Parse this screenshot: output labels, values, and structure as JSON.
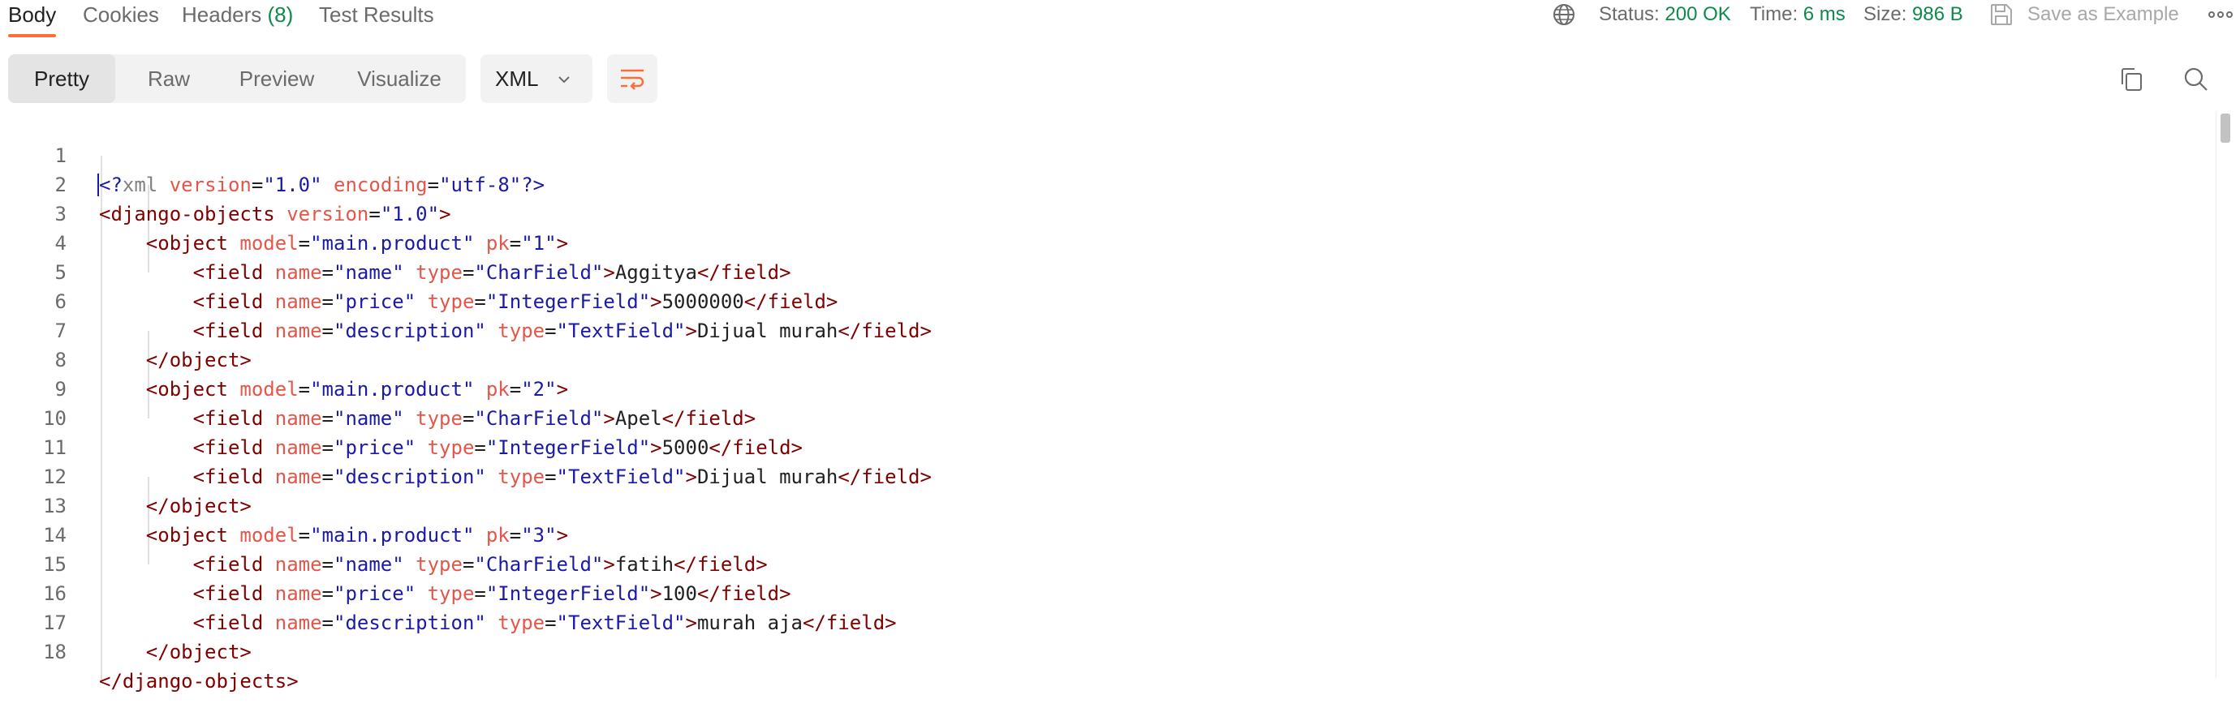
{
  "tabs": [
    {
      "label": "Body",
      "active": true
    },
    {
      "label": "Cookies"
    },
    {
      "label": "Headers",
      "count": "(8)"
    },
    {
      "label": "Test Results"
    }
  ],
  "response_meta": {
    "status_label": "Status:",
    "status_value": "200 OK",
    "time_label": "Time:",
    "time_value": "6 ms",
    "size_label": "Size:",
    "size_value": "986 B"
  },
  "save_label": "Save as Example",
  "view_modes": [
    "Pretty",
    "Raw",
    "Preview",
    "Visualize"
  ],
  "format": "XML",
  "icons": {
    "globe": "globe-icon",
    "save": "save-icon",
    "more": "more-icon",
    "chevron": "chevron-down-icon",
    "wrap": "wrap-lines-icon",
    "copy": "copy-icon",
    "search": "search-icon"
  },
  "colors": {
    "accent": "#ff6c37",
    "success": "#0d8a4b",
    "tag": "#800000",
    "attribute": "#e45649",
    "attribute_value": "#1a1aa6"
  },
  "code_lines": [
    "1",
    "2",
    "3",
    "4",
    "5",
    "6",
    "7",
    "8",
    "9",
    "10",
    "11",
    "12",
    "13",
    "14",
    "15",
    "16",
    "17",
    "18"
  ],
  "code": {
    "pi_open": "<?",
    "pi_name": "xml",
    "pi_attr1": "version",
    "pi_val1": "\"1.0\"",
    "pi_attr2": "encoding",
    "pi_val2": "\"utf-8\"",
    "pi_close": "?>",
    "root_open": "<django-objects",
    "root_attr": "version",
    "root_val": "\"1.0\"",
    "root_close": "</django-objects>",
    "object_tag": "<object",
    "object_close": "</object>",
    "model_attr": "model",
    "model_val": "\"main.product\"",
    "pk_attr": "pk",
    "field_tag": "<field",
    "field_close": "</field>",
    "name_attr": "name",
    "type_attr": "type",
    "objects": [
      {
        "pk": "\"1\"",
        "fields": [
          {
            "name": "\"name\"",
            "type": "\"CharField\"",
            "value": "Aggitya"
          },
          {
            "name": "\"price\"",
            "type": "\"IntegerField\"",
            "value": "5000000"
          },
          {
            "name": "\"description\"",
            "type": "\"TextField\"",
            "value": "Dijual murah"
          }
        ]
      },
      {
        "pk": "\"2\"",
        "fields": [
          {
            "name": "\"name\"",
            "type": "\"CharField\"",
            "value": "Apel"
          },
          {
            "name": "\"price\"",
            "type": "\"IntegerField\"",
            "value": "5000"
          },
          {
            "name": "\"description\"",
            "type": "\"TextField\"",
            "value": "Dijual murah"
          }
        ]
      },
      {
        "pk": "\"3\"",
        "fields": [
          {
            "name": "\"name\"",
            "type": "\"CharField\"",
            "value": "fatih"
          },
          {
            "name": "\"price\"",
            "type": "\"IntegerField\"",
            "value": "100"
          },
          {
            "name": "\"description\"",
            "type": "\"TextField\"",
            "value": "murah aja"
          }
        ]
      }
    ]
  }
}
